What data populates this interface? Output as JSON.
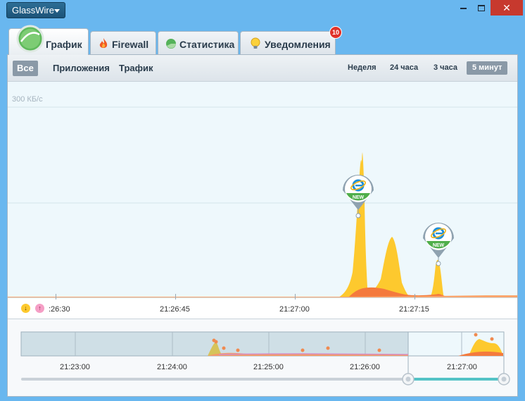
{
  "window": {
    "app_menu_label": "GlassWire",
    "close_glyph": "✕"
  },
  "tabs": [
    {
      "label": "График",
      "icon": "glasswire-logo-icon"
    },
    {
      "label": "Firewall",
      "icon": "flame-icon"
    },
    {
      "label": "Статистика",
      "icon": "pie-chart-icon"
    },
    {
      "label": "Уведомления",
      "icon": "bulb-icon"
    }
  ],
  "notification_count": "10",
  "subnav": {
    "filters": [
      "Все",
      "Приложения",
      "Трафик"
    ],
    "ranges": [
      "Неделя",
      "24 часа",
      "3 часа",
      "5 минут"
    ]
  },
  "graph": {
    "scale_label": "300 КБ/с",
    "time_labels": [
      ":26:30",
      "21:26:45",
      "21:27:00",
      "21:27:15"
    ],
    "new_app_markers": [
      {
        "app": "internet-explorer-icon",
        "label": "NEW"
      },
      {
        "app": "internet-explorer-icon",
        "label": "NEW"
      }
    ],
    "download_glyph": "↓",
    "upload_glyph": "↑"
  },
  "overview": {
    "time_labels": [
      "21:23:00",
      "21:24:00",
      "21:25:00",
      "21:26:00",
      "21:27:00"
    ]
  },
  "colors": {
    "download": "#fdc92e",
    "upload": "#f47a3c",
    "accent": "#54c3c6",
    "titlebar": "#69b7ef"
  }
}
